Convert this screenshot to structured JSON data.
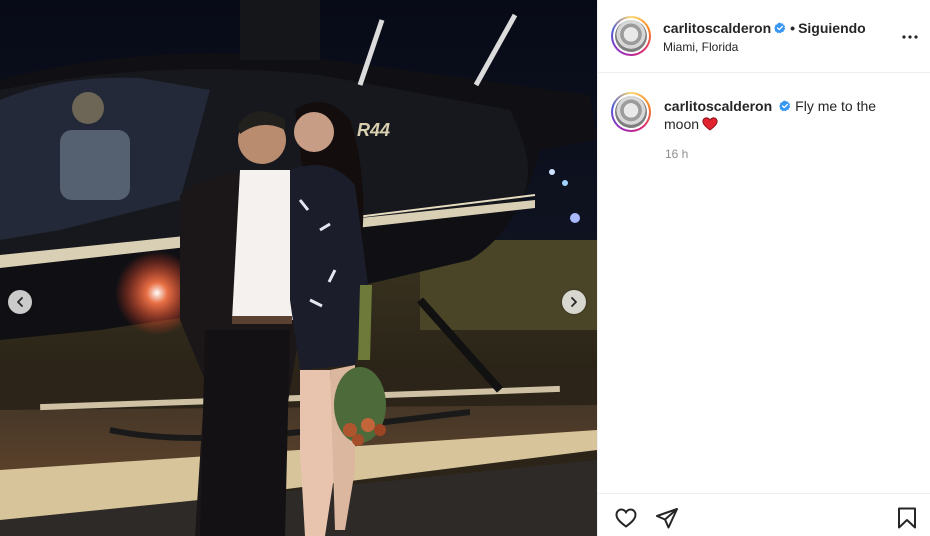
{
  "post": {
    "username": "carlitoscalderon",
    "separator": "•",
    "follow_status": "Siguiendo",
    "location": "Miami, Florida",
    "verified": true
  },
  "caption": {
    "username": "carlitoscalderon",
    "text": "Fly me to the moon",
    "emoji": "heart",
    "time": "16 h"
  },
  "photo": {
    "tail_text": "R44",
    "carousel": {
      "prev_icon": "chevron-left-icon",
      "next_icon": "chevron-right-icon"
    }
  },
  "actions": {
    "icons": [
      "heart-icon",
      "share-icon",
      "bookmark-icon"
    ]
  },
  "colors": {
    "verified": "#3897f0",
    "heart": "#e0232e",
    "secondary_text": "#8e8e8e",
    "border": "#efefef"
  }
}
